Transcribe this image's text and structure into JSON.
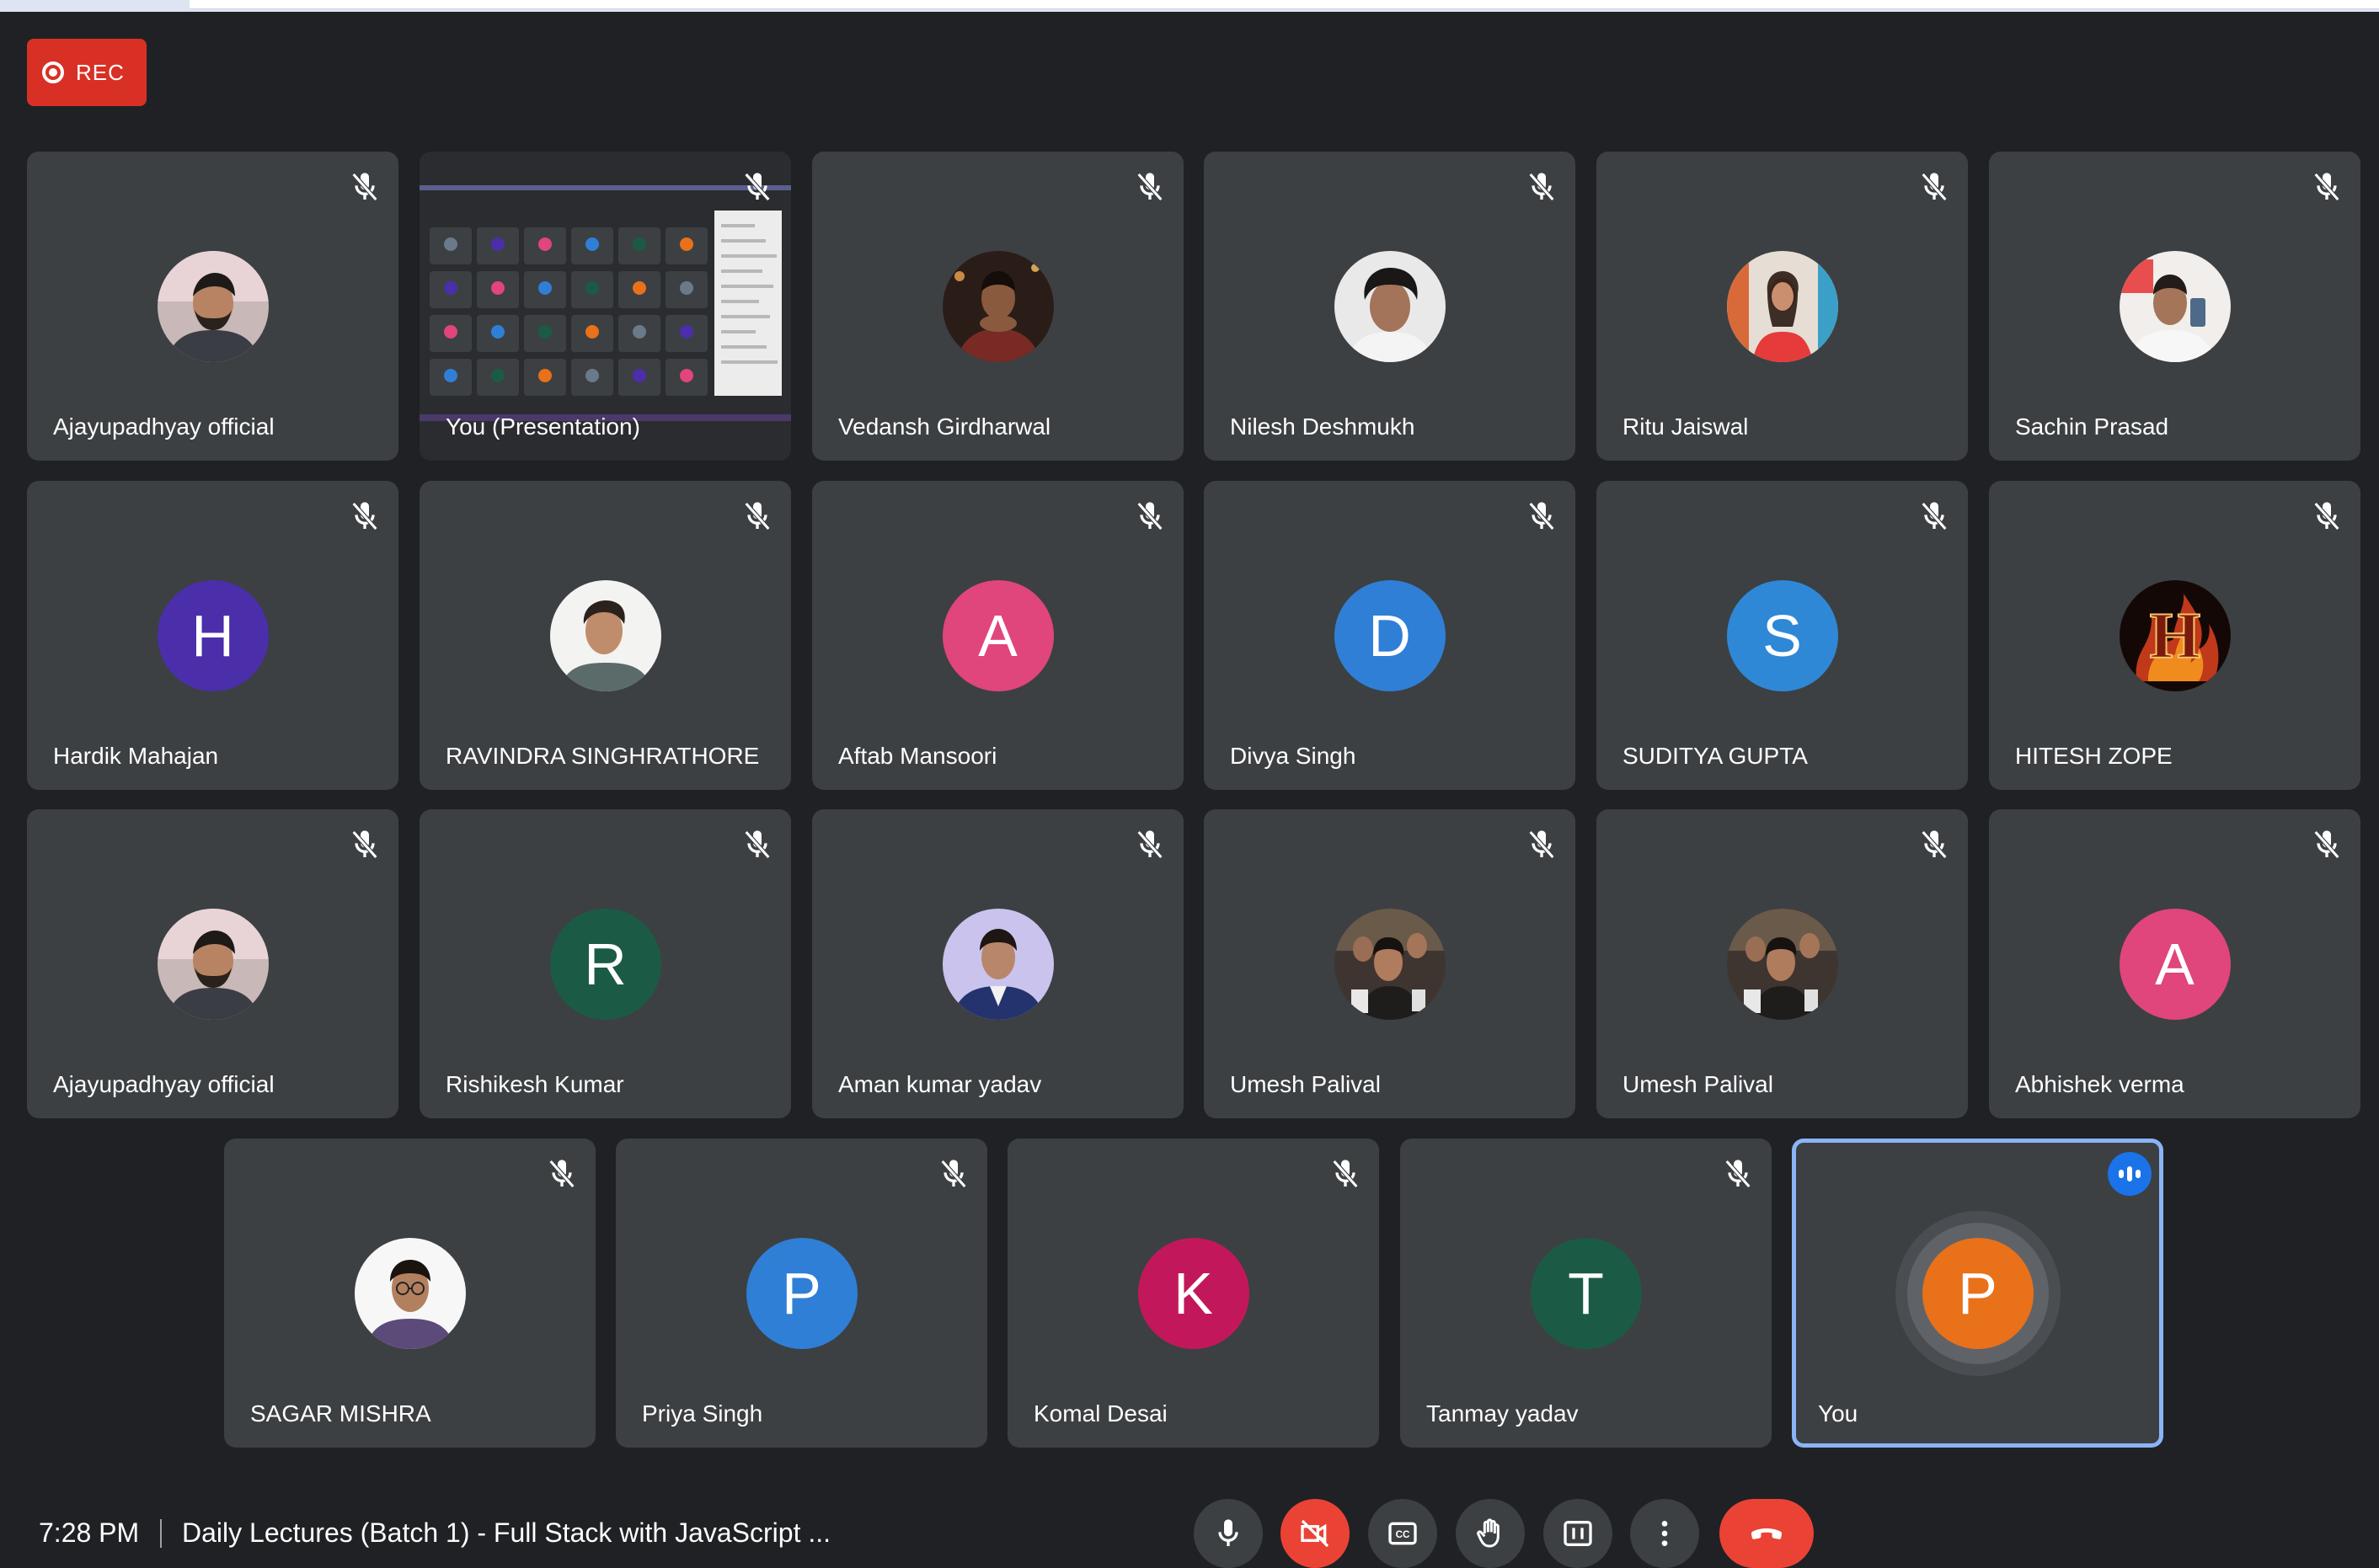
{
  "recording": {
    "label": "REC"
  },
  "participants": [
    {
      "name": "Ajayupadhyay official",
      "type": "photo",
      "photo": "man-beard"
    },
    {
      "name": "You (Presentation)",
      "type": "presentation"
    },
    {
      "name": "Vedansh Girdharwal",
      "type": "photo",
      "photo": "man-dark"
    },
    {
      "name": "Nilesh Deshmukh",
      "type": "photo",
      "photo": "man-hair"
    },
    {
      "name": "Ritu Jaiswal",
      "type": "photo",
      "photo": "woman-red"
    },
    {
      "name": "Sachin Prasad",
      "type": "photo",
      "photo": "man-selfie"
    },
    {
      "name": "Hardik Mahajan",
      "type": "initial",
      "initial": "H",
      "color": "#4b2eaa"
    },
    {
      "name": "RAVINDRA SINGHRATHORE",
      "type": "photo",
      "photo": "man-light"
    },
    {
      "name": "Aftab Mansoori",
      "type": "initial",
      "initial": "A",
      "color": "#e0457b"
    },
    {
      "name": "Divya Singh",
      "type": "initial",
      "initial": "D",
      "color": "#2f7fd6"
    },
    {
      "name": "SUDITYA GUPTA",
      "type": "initial",
      "initial": "S",
      "color": "#2f88d6"
    },
    {
      "name": "HITESH ZOPE",
      "type": "photo",
      "photo": "fire-h"
    },
    {
      "name": "Ajayupadhyay official",
      "type": "photo",
      "photo": "man-beard"
    },
    {
      "name": "Rishikesh Kumar",
      "type": "initial",
      "initial": "R",
      "color": "#1b5b45"
    },
    {
      "name": "Aman kumar yadav",
      "type": "photo",
      "photo": "man-suit"
    },
    {
      "name": "Umesh Palival",
      "type": "photo",
      "photo": "group"
    },
    {
      "name": "Umesh Palival",
      "type": "photo",
      "photo": "group"
    },
    {
      "name": "Abhishek verma",
      "type": "initial",
      "initial": "A",
      "color": "#e0457b"
    },
    {
      "name": "SAGAR MISHRA",
      "type": "photo",
      "photo": "man-glasses"
    },
    {
      "name": "Priya Singh",
      "type": "initial",
      "initial": "P",
      "color": "#2f7fd6"
    },
    {
      "name": "Komal Desai",
      "type": "initial",
      "initial": "K",
      "color": "#c2185b"
    },
    {
      "name": "Tanmay yadav",
      "type": "initial",
      "initial": "T",
      "color": "#1b5b45"
    },
    {
      "name": "You",
      "type": "self",
      "initial": "P",
      "color": "#e8711a"
    }
  ],
  "footer": {
    "time": "7:28 PM",
    "meeting_title": "Daily Lectures (Batch 1) - Full Stack with JavaScript ..."
  },
  "controls": [
    "mic-icon",
    "camera-off-icon",
    "captions-icon",
    "raise-hand-icon",
    "present-icon",
    "more-vert-icon",
    "end-call-icon"
  ],
  "colors": {
    "background": "#202124",
    "tile": "#3c4043",
    "accent": "#8ab4f8",
    "danger": "#ea4335"
  }
}
